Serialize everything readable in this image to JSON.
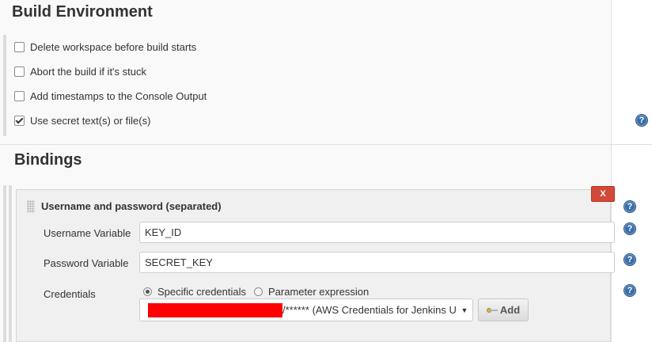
{
  "build_environment": {
    "title": "Build Environment",
    "options": [
      {
        "label": "Delete workspace before build starts",
        "checked": false
      },
      {
        "label": "Abort the build if it's stuck",
        "checked": false
      },
      {
        "label": "Add timestamps to the Console Output",
        "checked": false
      },
      {
        "label": "Use secret text(s) or file(s)",
        "checked": true
      }
    ]
  },
  "bindings": {
    "title": "Bindings",
    "panel": {
      "title": "Username and password (separated)",
      "delete_label": "X",
      "username_label": "Username Variable",
      "username_value": "KEY_ID",
      "password_label": "Password Variable",
      "password_value": "SECRET_KEY",
      "credentials_label": "Credentials",
      "radio_specific": "Specific credentials",
      "radio_parameter": "Parameter expression",
      "radio_selected": "specific",
      "credential_selected": "/****** (AWS Credentials for Jenkins U",
      "add_label": "Add"
    }
  },
  "help_label": "?",
  "colors": {
    "delete_red": "#d24939",
    "redaction": "#ff0000",
    "help_blue": "#3a6ea8"
  }
}
